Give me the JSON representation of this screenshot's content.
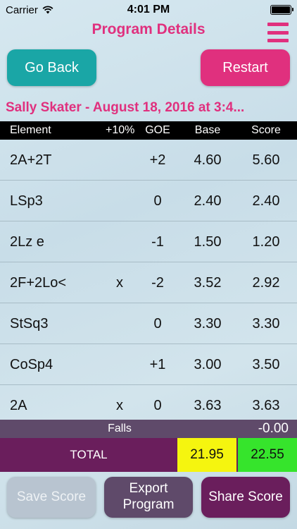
{
  "status_bar": {
    "carrier": "Carrier",
    "time": "4:01 PM"
  },
  "nav": {
    "title": "Program Details"
  },
  "buttons": {
    "go_back": "Go Back",
    "restart": "Restart",
    "save_score": "Save Score",
    "export_program": "Export Program",
    "share_score": "Share Score"
  },
  "program": {
    "heading": "Sally Skater - August 18, 2016 at 3:4..."
  },
  "table": {
    "headers": {
      "element": "Element",
      "bonus": "+10%",
      "goe": "GOE",
      "base": "Base",
      "score": "Score"
    },
    "rows": [
      {
        "element": "2A+2T",
        "bonus": "",
        "goe": "+2",
        "base": "4.60",
        "score": "5.60"
      },
      {
        "element": "LSp3",
        "bonus": "",
        "goe": "0",
        "base": "2.40",
        "score": "2.40"
      },
      {
        "element": "2Lz e",
        "bonus": "",
        "goe": "-1",
        "base": "1.50",
        "score": "1.20"
      },
      {
        "element": "2F+2Lo<",
        "bonus": "x",
        "goe": "-2",
        "base": "3.52",
        "score": "2.92"
      },
      {
        "element": "StSq3",
        "bonus": "",
        "goe": "0",
        "base": "3.30",
        "score": "3.30"
      },
      {
        "element": "CoSp4",
        "bonus": "",
        "goe": "+1",
        "base": "3.00",
        "score": "3.50"
      },
      {
        "element": "2A",
        "bonus": "x",
        "goe": "0",
        "base": "3.63",
        "score": "3.63"
      }
    ]
  },
  "falls": {
    "label": "Falls",
    "value": "-0.00"
  },
  "total": {
    "label": "TOTAL",
    "base": "21.95",
    "score": "22.55"
  },
  "colors": {
    "accent_pink": "#e0307e",
    "teal": "#1aa6a6",
    "purple_dark": "#6a1e5c",
    "purple_gray": "#5f4a6a",
    "total_base_yellow": "#f5f50f",
    "total_score_green": "#36e42c"
  }
}
